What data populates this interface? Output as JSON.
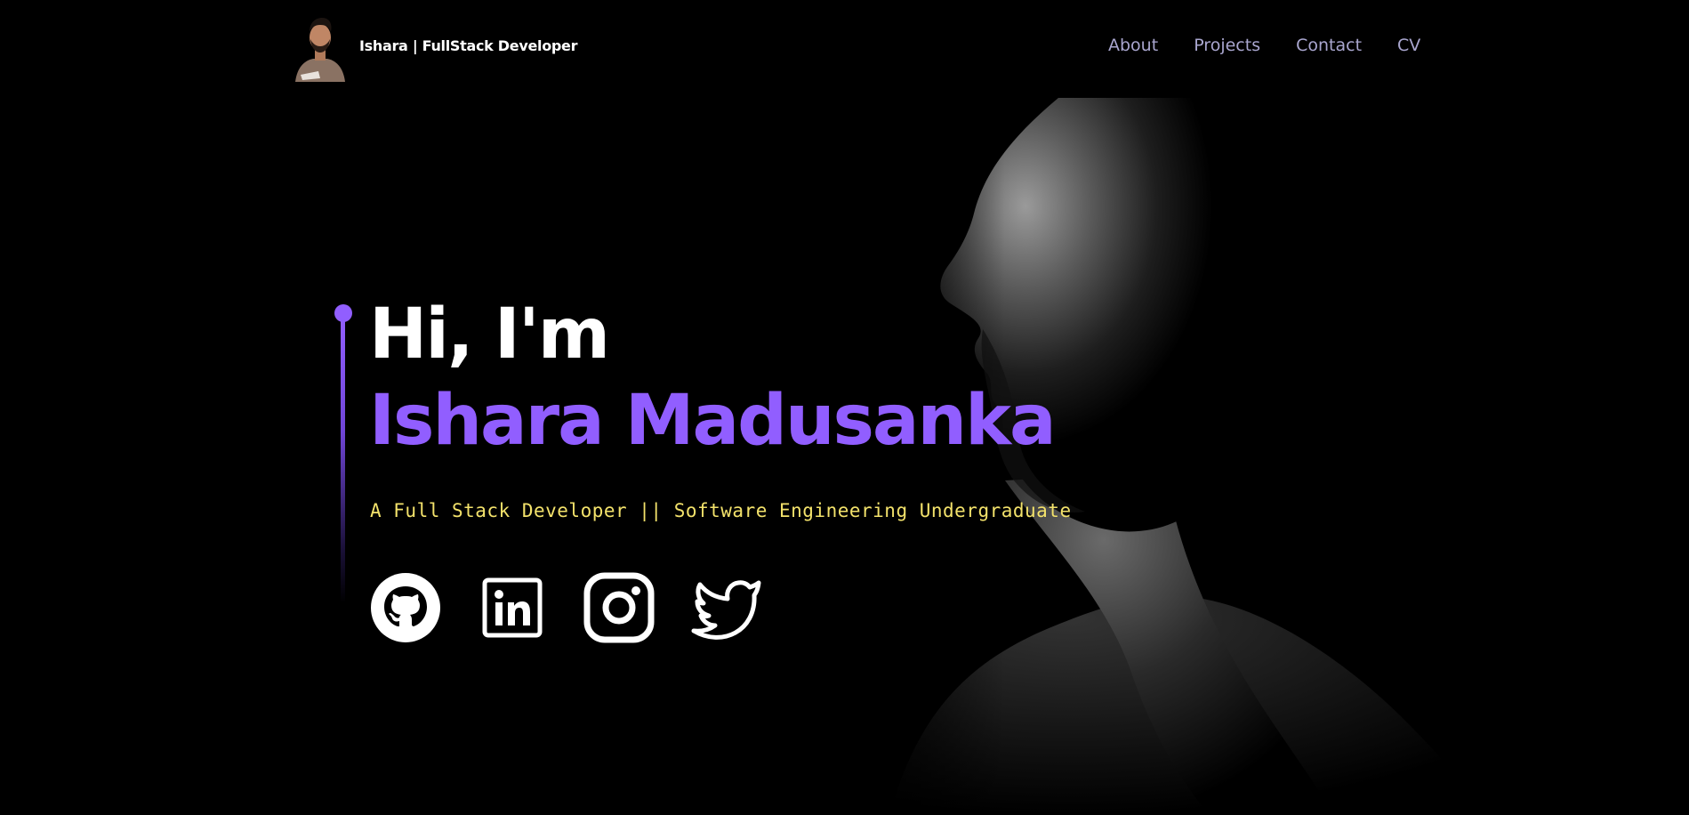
{
  "header": {
    "brand_name": "Ishara | FullStack Developer",
    "avatar_icon": "avatar-photo",
    "nav": [
      {
        "label": "About"
      },
      {
        "label": "Projects"
      },
      {
        "label": "Contact"
      },
      {
        "label": "CV"
      }
    ]
  },
  "hero": {
    "greeting": "Hi, I'm",
    "name": "Ishara Madusanka",
    "tagline": "A Full Stack Developer || Software Engineering Undergraduate",
    "socials": [
      {
        "icon": "github-icon"
      },
      {
        "icon": "linkedin-icon"
      },
      {
        "icon": "instagram-icon"
      },
      {
        "icon": "twitter-icon"
      }
    ]
  },
  "colors": {
    "background": "#000000",
    "accent": "#915eff",
    "tagline": "#f3e26b",
    "nav": "#a9a6cf",
    "text": "#ffffff"
  }
}
